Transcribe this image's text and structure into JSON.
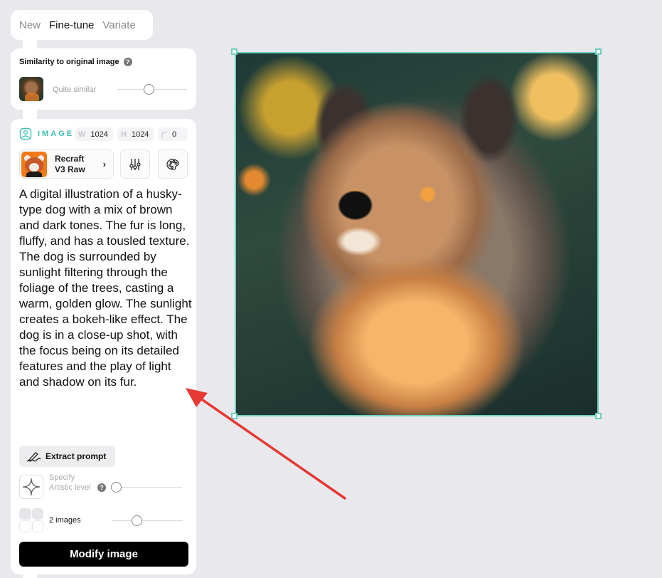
{
  "tabs": [
    {
      "label": "New",
      "active": false
    },
    {
      "label": "Fine-tune",
      "active": true
    },
    {
      "label": "Variate",
      "active": false
    }
  ],
  "similarity": {
    "title": "Similarity to original image",
    "help_icon": "question-icon",
    "value_label": "Quite similar",
    "slider_fraction": 0.45
  },
  "image_settings": {
    "label": "IMAGE",
    "width_key": "W",
    "width": "1024",
    "height_key": "H",
    "height": "1024",
    "corner_radius": "0"
  },
  "model": {
    "name_line1": "Recraft",
    "name_line2": "V3 Raw",
    "chevron": "›"
  },
  "icon_buttons": [
    "sliders-icon",
    "palette-icon"
  ],
  "prompt": "A digital illustration of a husky-type dog with a mix of brown and dark tones. The fur is long, fluffy, and has a tousled texture. The dog is surrounded by sunlight filtering through the foliage of the trees, casting a warm, golden glow. The sunlight creates a bokeh-like effect. The dog is in a close-up shot, with the focus being on its detailed features and the play of light and shadow on its fur.",
  "extract_button": "Extract prompt",
  "artistic": {
    "label": "Specify Artistic level",
    "slider_fraction": 0.0
  },
  "count": {
    "label": "2 images",
    "slider_fraction": 0.35
  },
  "modify_button": "Modify image",
  "canvas": {
    "image_alt": "Husky-type dog portrait in golden sunlight",
    "selection_color": "#6fcfbf"
  },
  "annotation": {
    "arrow_color": "#e53935"
  },
  "colors": {
    "accent": "#3cbfae",
    "background": "#e9e9ed",
    "primary_button": "#000000"
  }
}
